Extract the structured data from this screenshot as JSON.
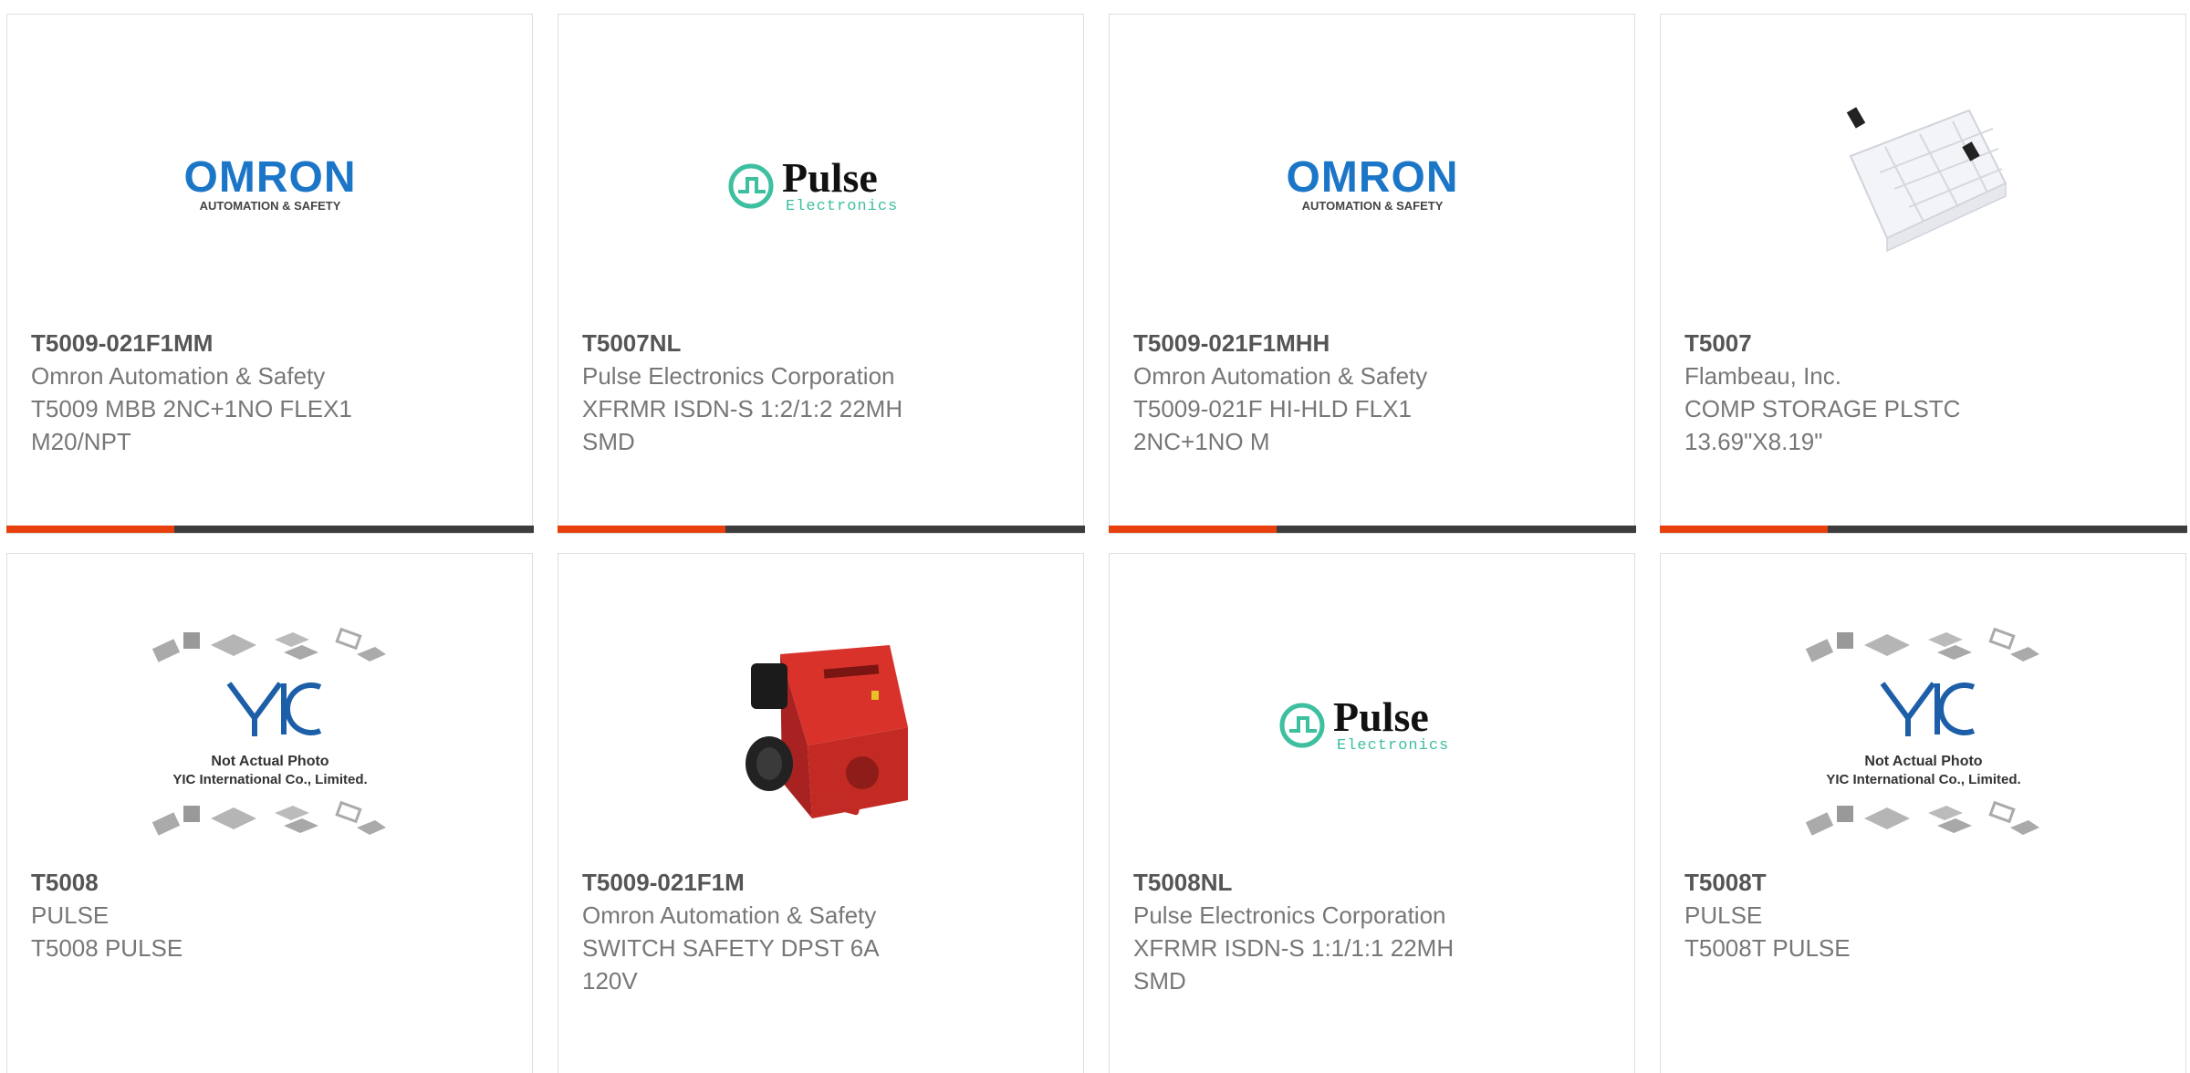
{
  "colors": {
    "accent": "#e8400c",
    "bar": "#3d3d3d",
    "omron_blue": "#1c76c8",
    "pulse_green": "#3dbfa0"
  },
  "brands": {
    "omron": {
      "name": "OMRON",
      "tagline": "AUTOMATION & SAFETY"
    },
    "pulse": {
      "name": "Pulse",
      "tagline": "Electronics"
    },
    "yic": {
      "name": "YIC",
      "line1": "Not Actual Photo",
      "line2": "YIC International Co., Limited."
    }
  },
  "products": [
    {
      "part": "T5009-021F1MM",
      "manufacturer": "Omron Automation & Safety",
      "description": "T5009 MBB 2NC+1NO FLEX1\nM20/NPT",
      "image": "omron-logo"
    },
    {
      "part": "T5007NL",
      "manufacturer": "Pulse Electronics Corporation",
      "description": "XFRMR ISDN-S 1:2/1:2 22MH\nSMD",
      "image": "pulse-logo"
    },
    {
      "part": "T5009-021F1MHH",
      "manufacturer": "Omron Automation & Safety",
      "description": "T5009-021F HI-HLD FLX1\n2NC+1NO M",
      "image": "omron-logo"
    },
    {
      "part": "T5007",
      "manufacturer": "Flambeau, Inc.",
      "description": "COMP STORAGE PLSTC\n13.69\"X8.19\"",
      "image": "storage-box-photo"
    },
    {
      "part": "T5008",
      "manufacturer": "PULSE",
      "description": "T5008 PULSE",
      "image": "not-actual-photo"
    },
    {
      "part": "T5009-021F1M",
      "manufacturer": "Omron Automation & Safety",
      "description": "SWITCH SAFETY DPST 6A\n120V",
      "image": "safety-switch-photo"
    },
    {
      "part": "T5008NL",
      "manufacturer": "Pulse Electronics Corporation",
      "description": "XFRMR ISDN-S 1:1/1:1 22MH\nSMD",
      "image": "pulse-logo"
    },
    {
      "part": "T5008T",
      "manufacturer": "PULSE",
      "description": "T5008T PULSE",
      "image": "not-actual-photo"
    }
  ]
}
